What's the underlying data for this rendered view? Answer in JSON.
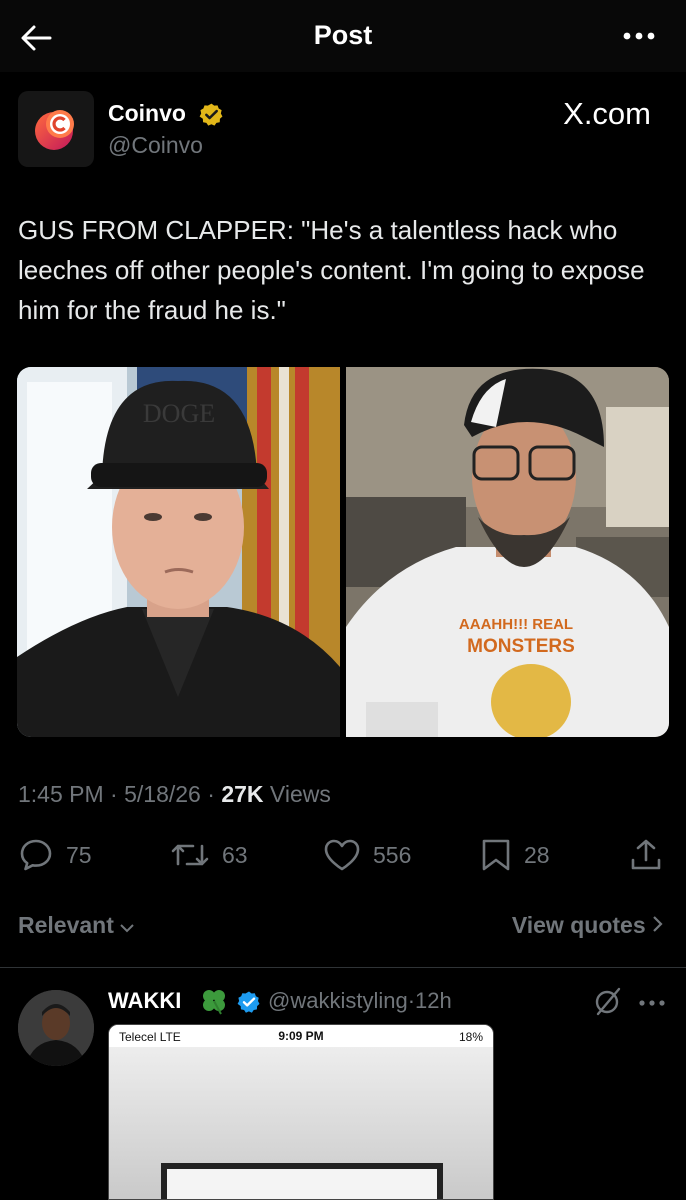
{
  "header": {
    "title": "Post",
    "back_icon": "arrow-left-icon",
    "more_icon": "ellipsis-icon"
  },
  "post": {
    "author_name": "Coinvo",
    "author_handle": "@Coinvo",
    "watermark": "X.com",
    "text": "GUS FROM CLAPPER: \"He's a talentless hack who leeches off other people's content. I'm going to expose him for the fraud he is.\"",
    "time": "1:45 PM",
    "date": "5/18/26",
    "views_count": "27K",
    "views_label": "Views",
    "replies": "75",
    "reposts": "63",
    "likes": "556",
    "bookmarks": "28"
  },
  "images": {
    "left_cap_text": "DOGE",
    "right_shirt_top": "AAAHH!!! REAL",
    "right_shirt_bottom": "MONSTERS"
  },
  "filters": {
    "sort_label": "Relevant",
    "quotes_label": "View quotes"
  },
  "reply": {
    "name": "WAKKI",
    "handle": "@wakkistyling",
    "time": "12h",
    "embed": {
      "carrier": "Telecel LTE",
      "clock": "9:09 PM",
      "battery": "18%"
    }
  },
  "colors": {
    "background": "#000000",
    "muted": "#71767b",
    "text": "#e7e9ea",
    "verified_gold": "#e2b719",
    "verified_blue": "#1d9bf0"
  }
}
